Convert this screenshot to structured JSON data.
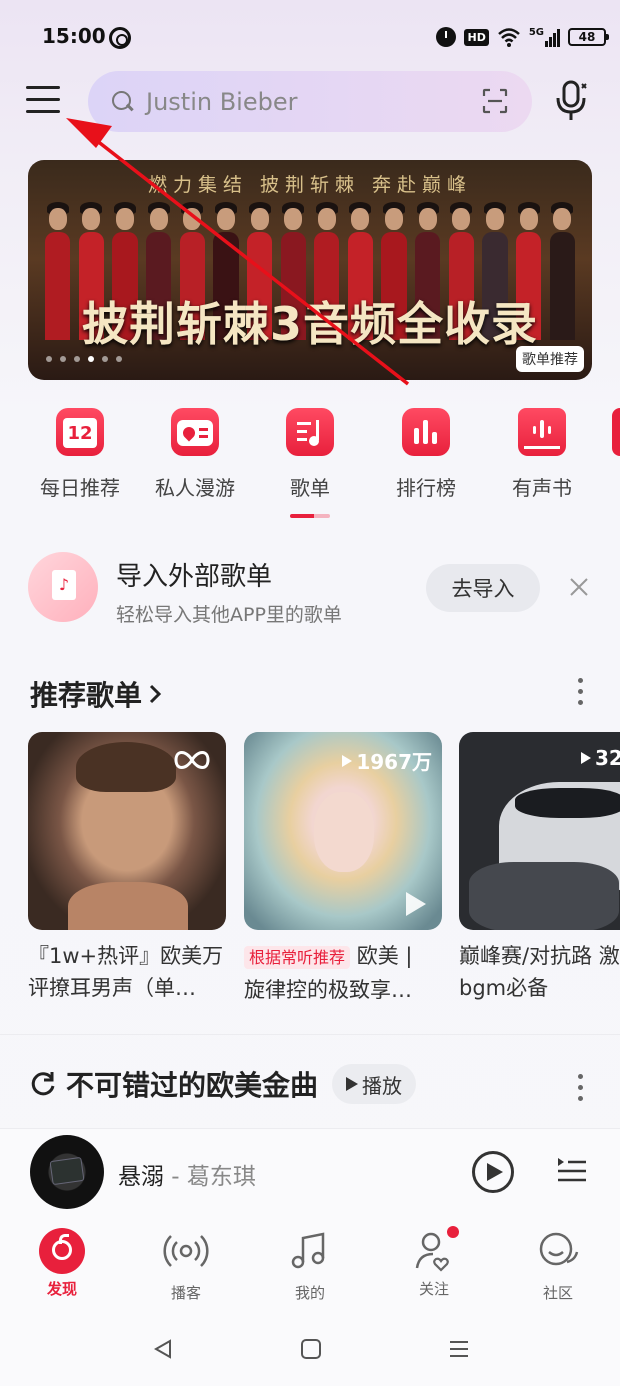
{
  "status_bar": {
    "time": "15:00",
    "network": "5G",
    "hd": "HD",
    "battery": "48"
  },
  "search": {
    "placeholder": "Justin Bieber"
  },
  "banner": {
    "top_text": "燃力集结 披荆斩棘 奔赴巅峰",
    "title": "披荆斩棘3音频全收录",
    "tag": "歌单推荐",
    "page_count": 6,
    "active_page": 3
  },
  "quick_nav": [
    {
      "label": "每日推荐",
      "icon": "calendar-icon",
      "badge": "12"
    },
    {
      "label": "私人漫游",
      "icon": "radio-icon"
    },
    {
      "label": "歌单",
      "icon": "playlist-icon"
    },
    {
      "label": "排行榜",
      "icon": "chart-icon"
    },
    {
      "label": "有声书",
      "icon": "audiobook-icon"
    }
  ],
  "import_card": {
    "title": "导入外部歌单",
    "subtitle": "轻松导入其他APP里的歌单",
    "button": "去导入"
  },
  "recommend": {
    "title": "推荐歌单",
    "playlists": [
      {
        "line1": "『1w+热评』欧美万",
        "line2": "评撩耳男声（单…",
        "count": ""
      },
      {
        "tag": "根据常听推荐",
        "line1": "欧美 |",
        "line2": "旋律控的极致享…",
        "count": "1967万"
      },
      {
        "line1": "巅峰赛/对抗路 激",
        "line2": "bgm必备",
        "count": "32"
      }
    ]
  },
  "section2": {
    "title": "不可错过的欧美金曲",
    "play_label": "播放"
  },
  "player": {
    "song": "悬溺",
    "separator": " - ",
    "artist": "葛东琪"
  },
  "bottom_nav": [
    {
      "label": "发现",
      "icon": "discover-icon",
      "active": true
    },
    {
      "label": "播客",
      "icon": "podcast-icon"
    },
    {
      "label": "我的",
      "icon": "music-note-icon"
    },
    {
      "label": "关注",
      "icon": "follow-icon",
      "dot": true
    },
    {
      "label": "社区",
      "icon": "community-icon"
    }
  ],
  "colors": {
    "accent": "#e8203c",
    "arrow": "#e8101a"
  }
}
